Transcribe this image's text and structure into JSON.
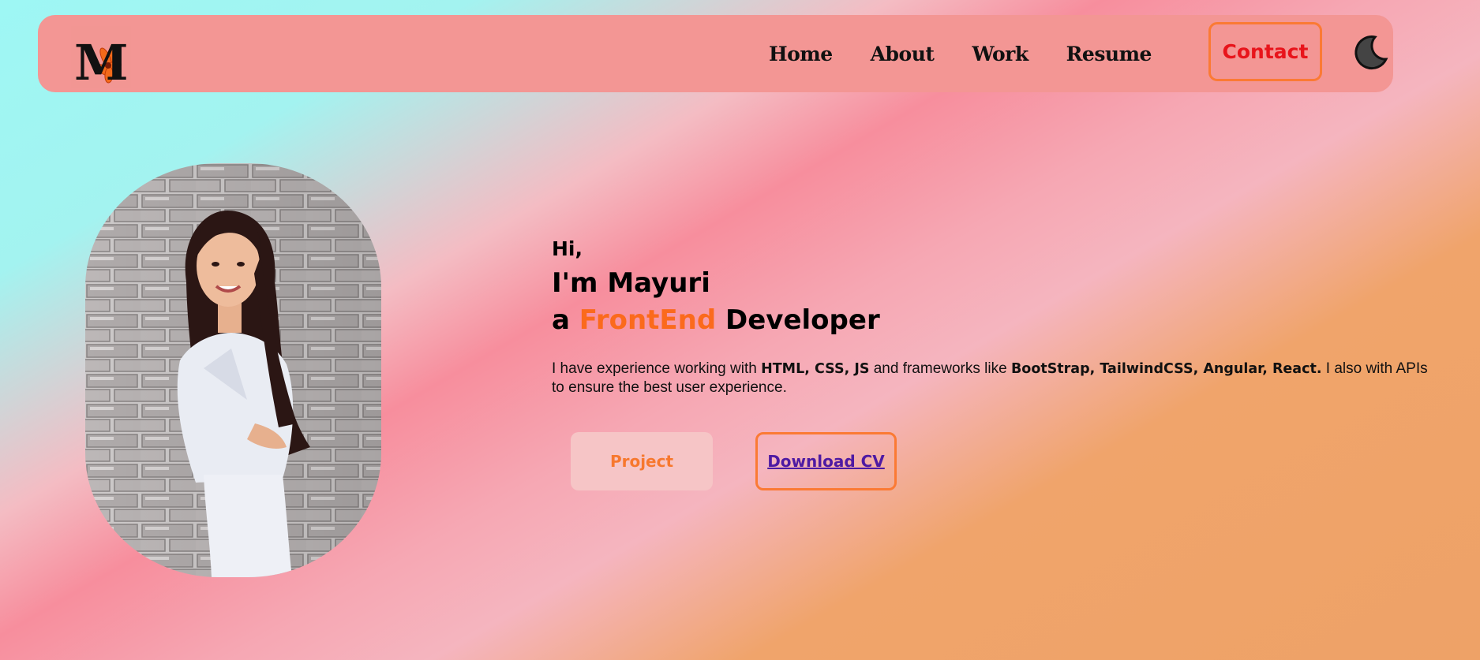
{
  "navbar": {
    "logo_letter": "M",
    "links": [
      "Home",
      "About",
      "Work",
      "Resume"
    ],
    "contact_label": "Contact"
  },
  "hero": {
    "greeting": "Hi,",
    "name_line": "I'm Mayuri",
    "role_prefix": "a ",
    "role_accent": "FrontEnd",
    "role_suffix": " Developer",
    "intro_part1": "I have experience working with ",
    "intro_bold1": "HTML, CSS, JS",
    "intro_part2": " and frameworks like ",
    "intro_bold2": "BootStrap, TailwindCSS, Angular, React.",
    "intro_part3": " I also with APIs to ensure the best user experience.",
    "project_label": "Project",
    "cv_label": "Download CV"
  },
  "colors": {
    "accent": "#fb6a1c",
    "navbar_bg": "#f39694",
    "contact_text": "#e8141b",
    "button_border": "#fb7a34",
    "cv_text": "#4e1aa3"
  },
  "icons": {
    "theme_toggle": "moon-icon"
  }
}
